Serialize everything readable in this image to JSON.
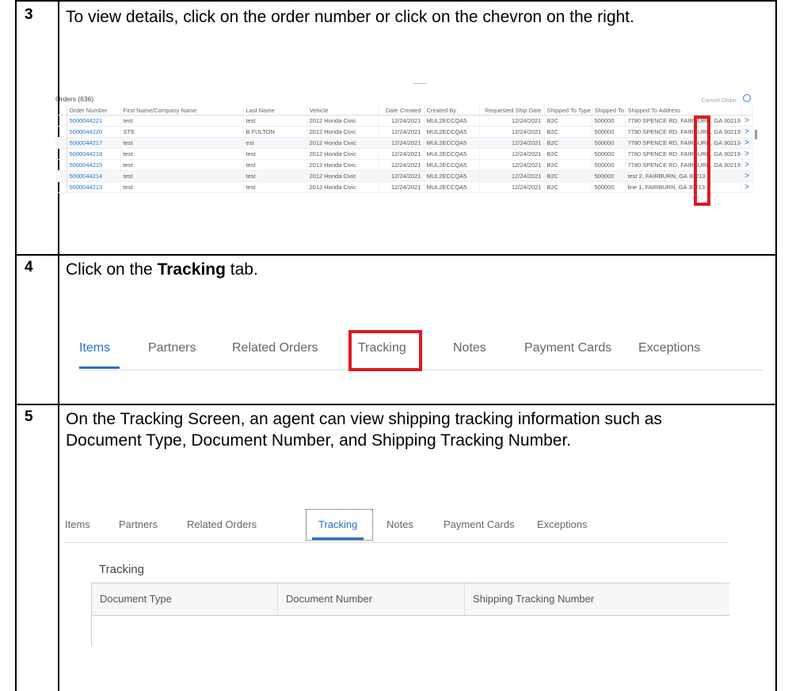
{
  "steps": [
    {
      "number": "3",
      "text": "To view details, click on the order number or click on the chevron on the right."
    },
    {
      "number": "4",
      "text_before": "Click on the ",
      "text_bold": "Tracking",
      "text_after": " tab."
    },
    {
      "number": "5",
      "text": "On the Tracking Screen, an agent can view shipping tracking information such as Document Type, Document Number, and Shipping Tracking Number."
    }
  ],
  "orders": {
    "title": "Orders (636)",
    "cancel_label": "Cancel Order",
    "columns": [
      "Order Number",
      "First Name/Company Name",
      "Last Name",
      "Vehicle",
      "Date Created",
      "Created By",
      "Requested Ship Date",
      "Shipped To Type",
      "Shipped To",
      "Shipped To Address"
    ],
    "rows": [
      [
        "5000044221",
        "test",
        "test",
        "2012 Honda Civic",
        "12/24/2021",
        "MUL2ECCQA5",
        "12/24/2021",
        "B2C",
        "500000",
        "7780 SPENCE RD, FAIRBURN, GA 30213-2947"
      ],
      [
        "5000044220",
        "STE",
        "B FULTON",
        "2012 Honda Civic",
        "12/24/2021",
        "MUL2ECCQA5",
        "12/24/2021",
        "B2C",
        "500000",
        "7780 SPENCE RD, FAIRBURN, GA 30213-2947"
      ],
      [
        "5000044217",
        "test",
        "est",
        "2012 Honda Civic",
        "12/24/2021",
        "MUL2ECCQA5",
        "12/24/2021",
        "B2C",
        "500000",
        "7780 SPENCE RD, FAIRBURN, GA 30213-2947"
      ],
      [
        "5000044216",
        "test",
        "test",
        "2012 Honda Civic",
        "12/24/2021",
        "MUL2ECCQA5",
        "12/24/2021",
        "B2C",
        "500000",
        "7780 SPENCE RD, FAIRBURN, GA 30213-2947"
      ],
      [
        "5000044215",
        "test",
        "test",
        "2012 Honda Civic",
        "12/24/2021",
        "MUL2ECCQA5",
        "12/24/2021",
        "B2C",
        "500000",
        "7780 SPENCE RD, FAIRBURN, GA 30213-2947"
      ],
      [
        "5000044214",
        "test",
        "test",
        "2012 Honda Civic",
        "12/24/2021",
        "MUL2ECCQA5",
        "12/24/2021",
        "B2C",
        "500000",
        "test 2, FAIRBURN, GA 30213"
      ],
      [
        "5000044213",
        "test",
        "test",
        "2012 Honda Civic",
        "12/24/2021",
        "MUL2ECCQA5",
        "12/24/2021",
        "B2C",
        "500000",
        "line 1, FAIRBURN, GA 30213"
      ]
    ],
    "chevron": ">"
  },
  "tabs": [
    "Items",
    "Partners",
    "Related Orders",
    "Tracking",
    "Notes",
    "Payment Cards",
    "Exceptions"
  ],
  "tracking": {
    "heading": "Tracking",
    "columns": [
      "Document Type",
      "Document Number",
      "Shipping Tracking Number"
    ]
  },
  "colors": {
    "highlight": "#e0191f",
    "link": "#2a6fc9"
  }
}
